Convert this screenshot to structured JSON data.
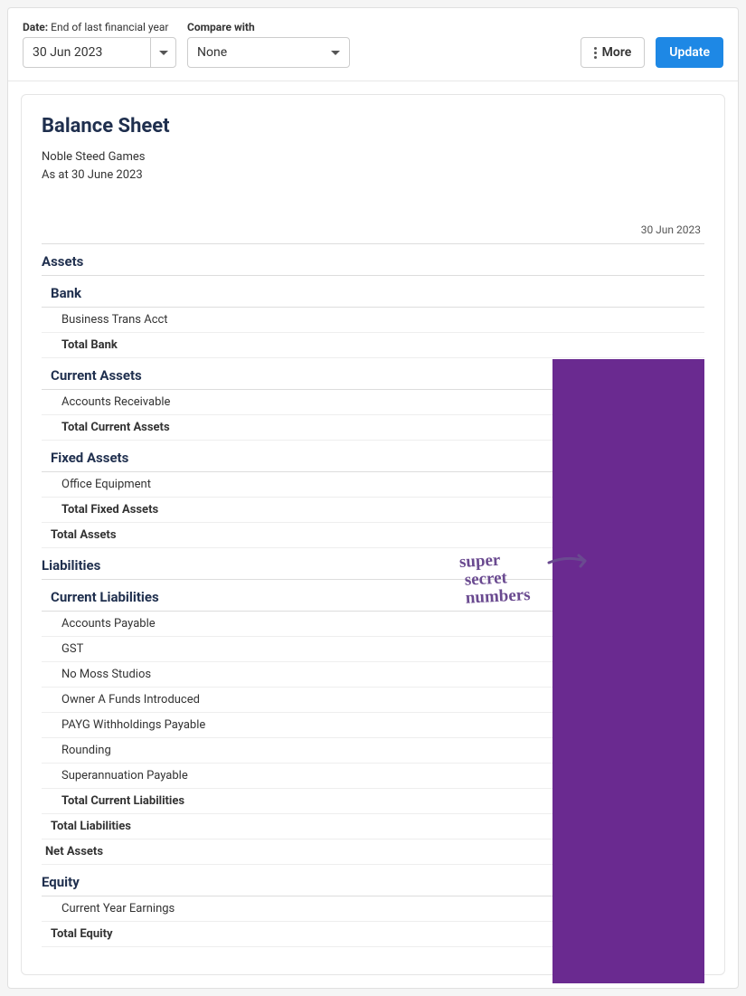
{
  "toolbar": {
    "date_label_prefix": "Date:",
    "date_label_suffix": " End of last financial year",
    "date_value": "30 Jun 2023",
    "compare_label": "Compare with",
    "compare_value": "None",
    "more_label": "More",
    "update_label": "Update"
  },
  "report": {
    "title": "Balance Sheet",
    "company": "Noble Steed Games",
    "as_at_label": "As at 30 June 2023",
    "column_date": "30 Jun 2023"
  },
  "sections": {
    "assets": "Assets",
    "bank": "Bank",
    "bank_items": {
      "business_trans": "Business Trans Acct"
    },
    "total_bank": "Total Bank",
    "current_assets": "Current Assets",
    "ca_items": {
      "ar": "Accounts Receivable"
    },
    "total_current_assets": "Total Current Assets",
    "fixed_assets": "Fixed Assets",
    "fa_items": {
      "office_equipment": "Office Equipment"
    },
    "total_fixed_assets": "Total Fixed Assets",
    "total_assets": "Total Assets",
    "liabilities": "Liabilities",
    "current_liabilities": "Current Liabilities",
    "cl_items": {
      "ap": "Accounts Payable",
      "gst": "GST",
      "nomoss": "No Moss Studios",
      "owner_a": "Owner A Funds Introduced",
      "payg": "PAYG Withholdings Payable",
      "rounding": "Rounding",
      "super": "Superannuation Payable"
    },
    "total_current_liabilities": "Total Current Liabilities",
    "total_liabilities": "Total Liabilities",
    "net_assets": "Net Assets",
    "equity": "Equity",
    "eq_items": {
      "cye": "Current Year Earnings"
    },
    "total_equity": "Total Equity"
  },
  "annotation": {
    "text": "super\n secret\n numbers"
  }
}
